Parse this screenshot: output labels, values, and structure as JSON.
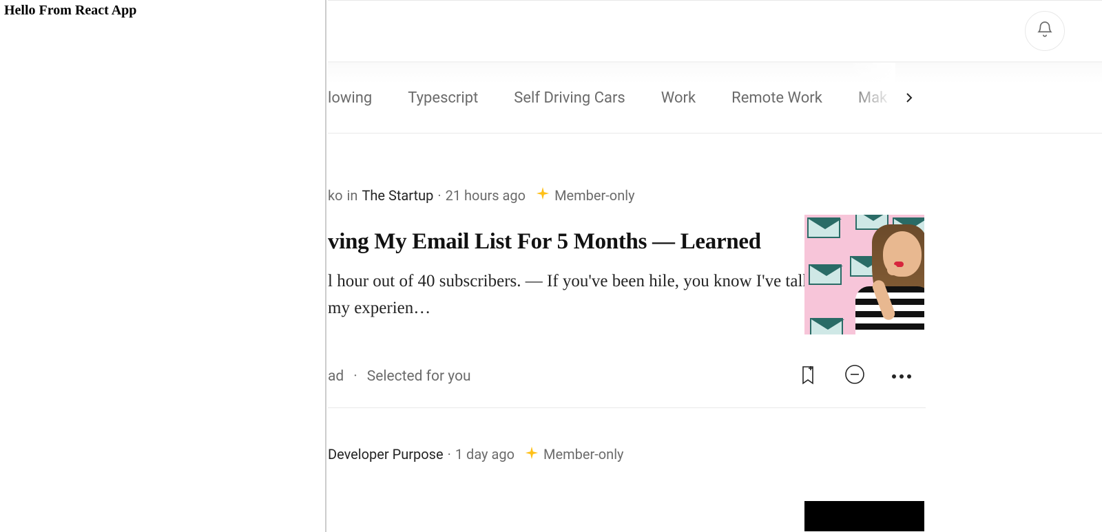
{
  "left": {
    "title": "Hello From React App"
  },
  "tabs": {
    "items": [
      "lowing",
      "Typescript",
      "Self Driving Cars",
      "Work",
      "Remote Work",
      "Mak"
    ]
  },
  "article1": {
    "author_fragment": "ko",
    "in_word": "in",
    "publication": "The Startup",
    "time": "21 hours ago",
    "member_only": "Member-only",
    "title": "ving My Email List For 5 Months — Learned",
    "excerpt": "l hour out of 40 subscribers. — If you've been hile, you know I've talked a lot about my experien…",
    "read_fragment": "ad",
    "selected": "Selected for you"
  },
  "article2": {
    "publication": "Developer Purpose",
    "time": "1 day ago",
    "member_only": "Member-only"
  }
}
